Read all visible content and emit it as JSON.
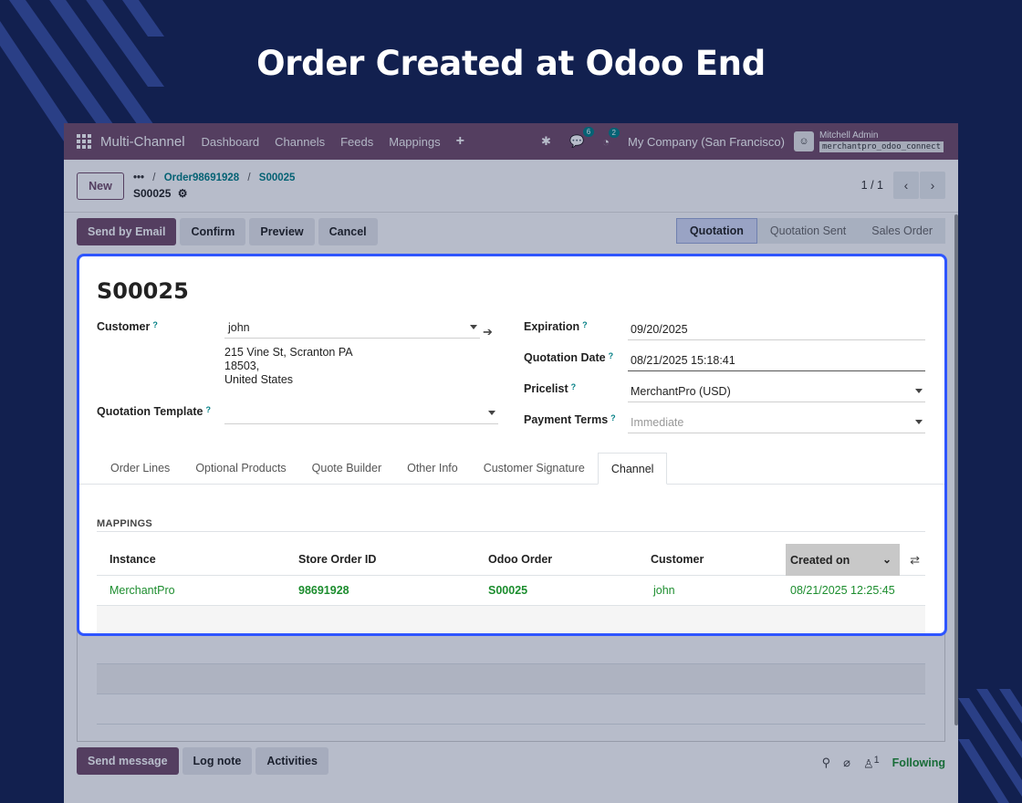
{
  "headline": "Order Created at Odoo End",
  "navbar": {
    "app_name": "Multi-Channel",
    "items": [
      "Dashboard",
      "Channels",
      "Feeds",
      "Mappings"
    ],
    "chat_badge": "6",
    "activity_badge": "2",
    "company": "My Company (San Francisco)",
    "user_name": "Mitchell Admin",
    "database": "merchantpro_odoo_connect"
  },
  "control": {
    "new_label": "New",
    "breadcrumb_more": "•••",
    "breadcrumb_parent": "Order98691928",
    "breadcrumb_current": "S00025",
    "record_name": "S00025",
    "pager": "1 / 1"
  },
  "actions": {
    "send_email": "Send by Email",
    "confirm": "Confirm",
    "preview": "Preview",
    "cancel": "Cancel",
    "stages": [
      "Quotation",
      "Quotation Sent",
      "Sales Order"
    ]
  },
  "form": {
    "title": "S00025",
    "customer_label": "Customer",
    "customer_value": "john",
    "address_line1": "215 Vine St, Scranton PA",
    "address_line2": "18503,",
    "address_line3": "United States",
    "template_label": "Quotation Template",
    "template_value": "",
    "expiration_label": "Expiration",
    "expiration_value": "09/20/2025",
    "quotation_date_label": "Quotation Date",
    "quotation_date_value": "08/21/2025 15:18:41",
    "pricelist_label": "Pricelist",
    "pricelist_value": "MerchantPro (USD)",
    "payment_terms_label": "Payment Terms",
    "payment_terms_placeholder": "Immediate",
    "help_mark": "?"
  },
  "tabs": [
    "Order Lines",
    "Optional Products",
    "Quote Builder",
    "Other Info",
    "Customer Signature",
    "Channel"
  ],
  "mappings": {
    "section_title": "MAPPINGS",
    "columns": [
      "Instance",
      "Store Order ID",
      "Odoo Order",
      "Customer",
      "Created on"
    ],
    "rows": [
      {
        "instance": "MerchantPro",
        "store_order_id": "98691928",
        "odoo_order": "S00025",
        "customer": "john",
        "created_on": "08/21/2025 12:25:45"
      }
    ]
  },
  "chatter": {
    "send_message": "Send message",
    "log_note": "Log note",
    "activities": "Activities",
    "follower_count": "1",
    "following": "Following"
  },
  "colors": {
    "brand": "#714b67",
    "highlight": "#2e55ff",
    "link_green": "#1c8d2e",
    "background": "#12204f"
  }
}
